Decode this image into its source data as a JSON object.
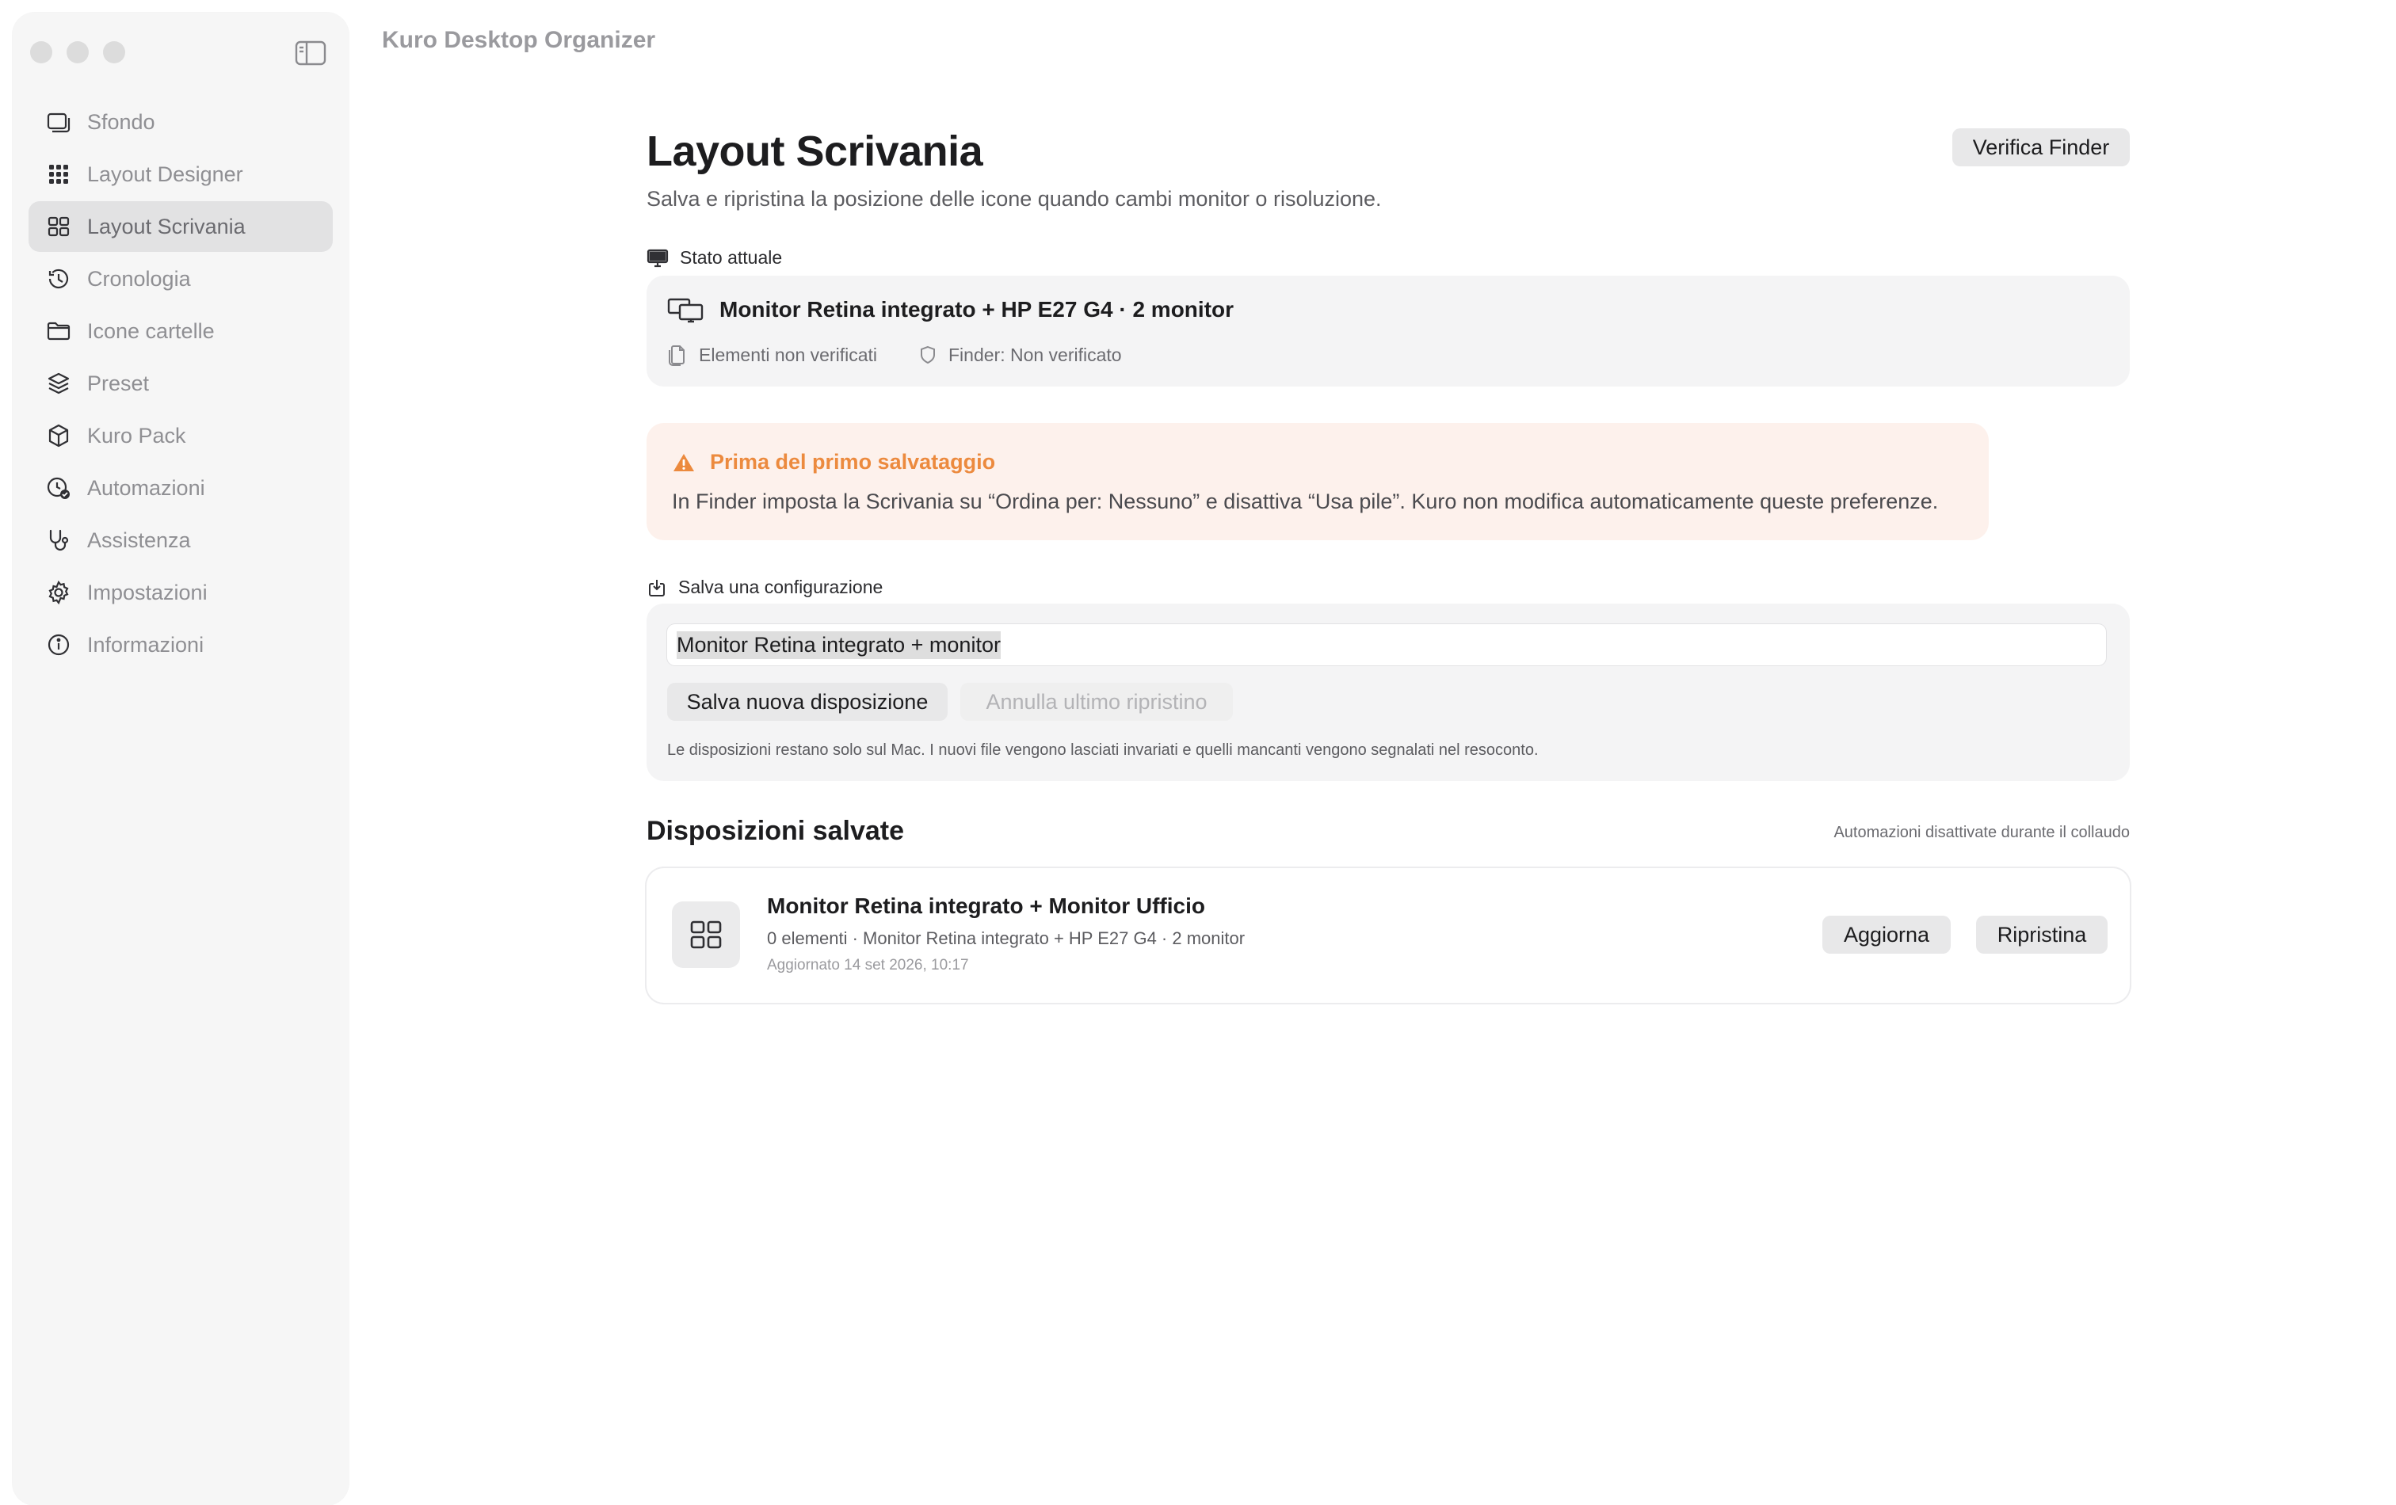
{
  "window": {
    "title": "Kuro Desktop Organizer",
    "controls": [
      "close-icon",
      "minimize-icon",
      "zoom-icon",
      "sidebar-toggle-icon"
    ]
  },
  "sidebar": {
    "items": [
      {
        "label": "Sfondo",
        "icon": "wallpaper-icon",
        "active": false
      },
      {
        "label": "Layout Designer",
        "icon": "grid-dots-icon",
        "active": false
      },
      {
        "label": "Layout Scrivania",
        "icon": "grid-icon",
        "active": true
      },
      {
        "label": "Cronologia",
        "icon": "history-icon",
        "active": false
      },
      {
        "label": "Icone cartelle",
        "icon": "folder-icon",
        "active": false
      },
      {
        "label": "Preset",
        "icon": "layers-icon",
        "active": false
      },
      {
        "label": "Kuro Pack",
        "icon": "box-icon",
        "active": false
      },
      {
        "label": "Automazioni",
        "icon": "clock-check-icon",
        "active": false
      },
      {
        "label": "Assistenza",
        "icon": "stethoscope-icon",
        "active": false
      },
      {
        "label": "Impostazioni",
        "icon": "gear-icon",
        "active": false
      },
      {
        "label": "Informazioni",
        "icon": "info-icon",
        "active": false
      }
    ]
  },
  "page": {
    "title": "Layout Scrivania",
    "subtitle": "Salva e ripristina la posizione delle icone quando cambi monitor o risoluzione.",
    "verify_button": "Verifica Finder"
  },
  "status": {
    "section_label": "Stato attuale",
    "monitor_text": "Monitor Retina integrato + HP E27 G4 · 2 monitor",
    "elements_text": "Elementi non verificati",
    "finder_text": "Finder: Non verificato"
  },
  "warning": {
    "title": "Prima del primo salvataggio",
    "text": "In Finder imposta la Scrivania su “Ordina per: Nessuno” e disattiva “Usa pile”. Kuro non modifica automaticamente queste preferenze.",
    "color": "#ec8a3e"
  },
  "save": {
    "section_label": "Salva una configurazione",
    "input_value": "Monitor Retina integrato + monitor",
    "save_button": "Salva nuova disposizione",
    "undo_button": "Annulla ultimo ripristino",
    "hint": "Le disposizioni restano solo sul Mac. I nuovi file vengono lasciati invariati e quelli mancanti vengono segnalati nel resoconto."
  },
  "saved": {
    "title": "Disposizioni salvate",
    "note": "Automazioni disattivate durante il collaudo",
    "items": [
      {
        "name": "Monitor Retina integrato + Monitor Ufficio",
        "meta": "0 elementi · Monitor Retina integrato + HP E27 G4 · 2 monitor",
        "date": "Aggiornato 14 set 2026, 10:17",
        "update_button": "Aggiorna",
        "restore_button": "Ripristina"
      }
    ]
  }
}
